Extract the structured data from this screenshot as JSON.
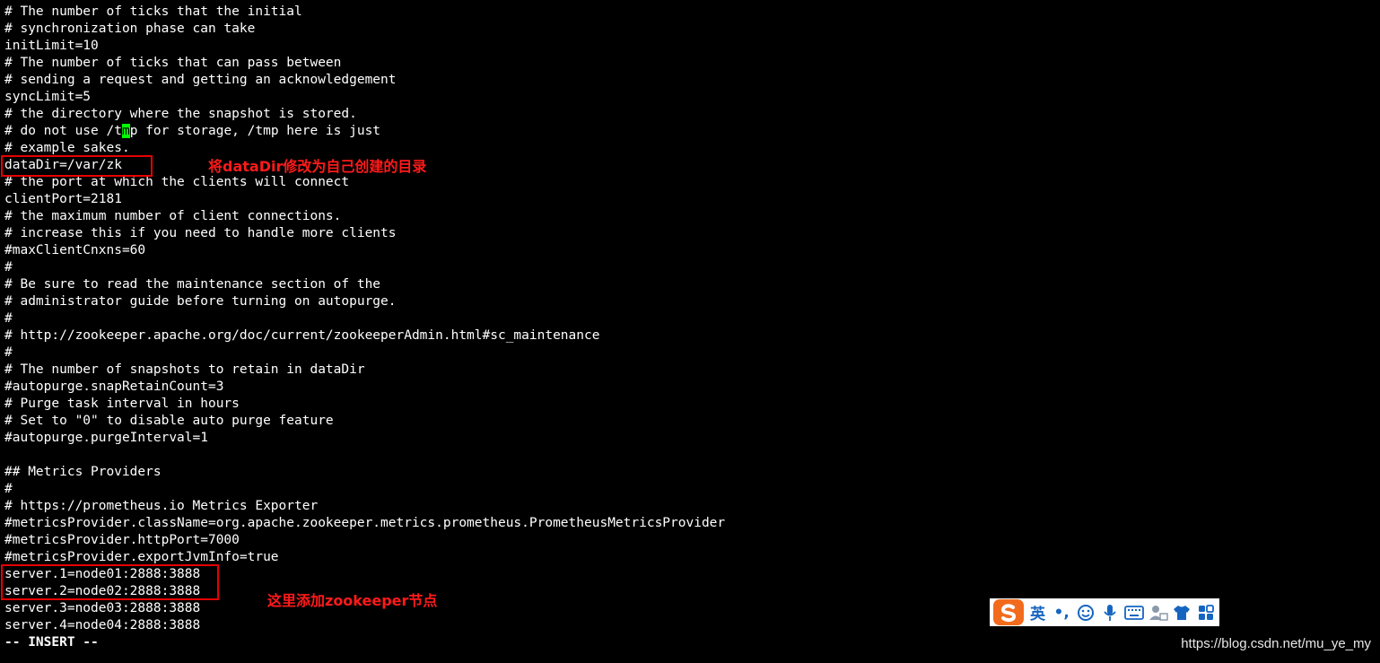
{
  "terminal": {
    "lines": [
      "# The number of ticks that the initial",
      "# synchronization phase can take",
      "initLimit=10",
      "# The number of ticks that can pass between",
      "# sending a request and getting an acknowledgement",
      "syncLimit=5",
      "# the directory where the snapshot is stored.",
      "# do not use /tmp for storage, /tmp here is just",
      "# example sakes.",
      "dataDir=/var/zk",
      "# the port at which the clients will connect",
      "clientPort=2181",
      "# the maximum number of client connections.",
      "# increase this if you need to handle more clients",
      "#maxClientCnxns=60",
      "#",
      "# Be sure to read the maintenance section of the",
      "# administrator guide before turning on autopurge.",
      "#",
      "# http://zookeeper.apache.org/doc/current/zookeeperAdmin.html#sc_maintenance",
      "#",
      "# The number of snapshots to retain in dataDir",
      "#autopurge.snapRetainCount=3",
      "# Purge task interval in hours",
      "# Set to \"0\" to disable auto purge feature",
      "#autopurge.purgeInterval=1",
      "",
      "## Metrics Providers",
      "#",
      "# https://prometheus.io Metrics Exporter",
      "#metricsProvider.className=org.apache.zookeeper.metrics.prometheus.PrometheusMetricsProvider",
      "#metricsProvider.httpPort=7000",
      "#metricsProvider.exportJvmInfo=true",
      "server.1=node01:2888:3888",
      "server.2=node02:2888:3888",
      "server.3=node03:2888:3888",
      "server.4=node04:2888:3888",
      "-- INSERT --"
    ],
    "cursor": {
      "line": 7,
      "col": 15
    },
    "mode_line": 37,
    "colors": {
      "background": "#000000",
      "text": "#ffffff",
      "cursor": "#00ff00"
    }
  },
  "annotations": {
    "datadir_note": "将dataDir修改为自己创建的目录",
    "servers_note": "这里添加zookeeper节点",
    "color": "#e60000"
  },
  "ime_toolbar": {
    "lang_label": "英",
    "punct_label": "•,",
    "icons": [
      "sogou-logo-icon",
      "smiley-icon",
      "microphone-icon",
      "keyboard-icon",
      "user-settings-icon",
      "skin-shirt-icon",
      "grid-apps-icon"
    ],
    "accent": "#f26b1d"
  },
  "watermark": "https://blog.csdn.net/mu_ye_my"
}
